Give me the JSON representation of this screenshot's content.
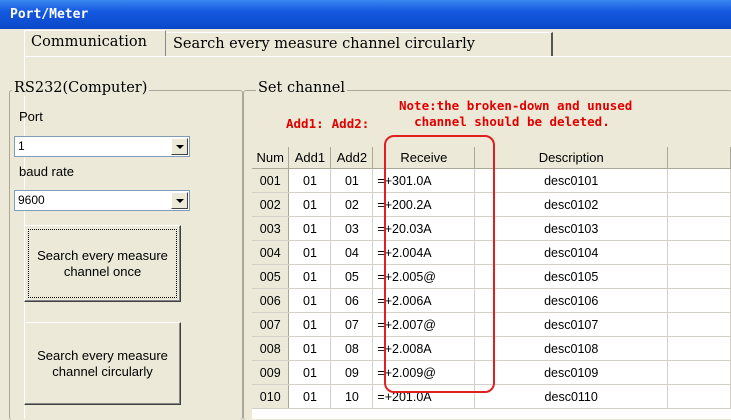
{
  "window": {
    "title": "Port/Meter"
  },
  "tabs": [
    {
      "label": "Communication",
      "active": true
    },
    {
      "label": "Search every measure channel circularly",
      "active": false
    }
  ],
  "rs232": {
    "group_title": "RS232(Computer)",
    "port_label": "Port",
    "port_value": "1",
    "baud_label": "baud rate",
    "baud_value": "9600",
    "search_once_button": "Search every measure channel once",
    "search_circular_button": "Search every measure channel circularly"
  },
  "set_channel": {
    "group_title": "Set channel",
    "add1_label": "Add1:",
    "add2_label": "Add2:",
    "note_line1": "Note:the broken-down and unused",
    "note_line2": "channel should be deleted."
  },
  "table": {
    "headers": [
      "Num",
      "Add1",
      "Add2",
      "Receive",
      "Description"
    ],
    "rows": [
      {
        "num": "001",
        "add1": "01",
        "add2": "01",
        "receive": "=+301.0A",
        "desc": "desc0101"
      },
      {
        "num": "002",
        "add1": "01",
        "add2": "02",
        "receive": "=+200.2A",
        "desc": "desc0102"
      },
      {
        "num": "003",
        "add1": "01",
        "add2": "03",
        "receive": "=+20.03A",
        "desc": "desc0103"
      },
      {
        "num": "004",
        "add1": "01",
        "add2": "04",
        "receive": "=+2.004A",
        "desc": "desc0104"
      },
      {
        "num": "005",
        "add1": "01",
        "add2": "05",
        "receive": "=+2.005@",
        "desc": "desc0105"
      },
      {
        "num": "006",
        "add1": "01",
        "add2": "06",
        "receive": "=+2.006A",
        "desc": "desc0106"
      },
      {
        "num": "007",
        "add1": "01",
        "add2": "07",
        "receive": "=+2.007@",
        "desc": "desc0107"
      },
      {
        "num": "008",
        "add1": "01",
        "add2": "08",
        "receive": "=+2.008A",
        "desc": "desc0108"
      },
      {
        "num": "009",
        "add1": "01",
        "add2": "09",
        "receive": "=+2.009@",
        "desc": "desc0109"
      },
      {
        "num": "010",
        "add1": "01",
        "add2": "10",
        "receive": "=+201.0A",
        "desc": "desc0110"
      }
    ]
  },
  "colors": {
    "title_bar": "#0a48c8",
    "note_text": "#e00000",
    "highlight": "#e02020"
  }
}
